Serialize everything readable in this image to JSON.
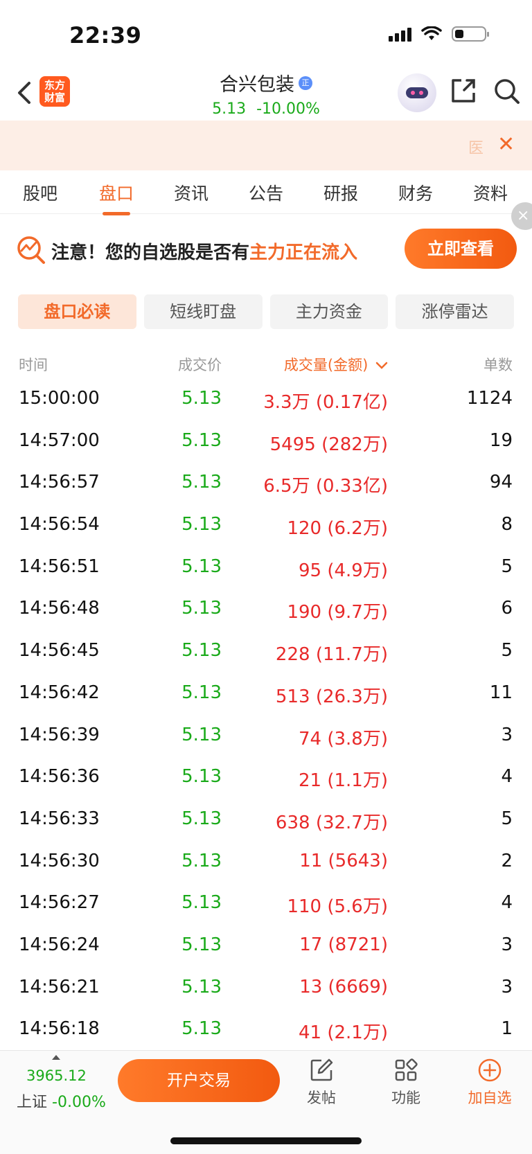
{
  "status_bar": {
    "time": "22:39"
  },
  "header": {
    "logo_line1": "东方",
    "logo_line2": "财富",
    "stock_name": "合兴包装",
    "stock_badge": "正",
    "price": "5.13",
    "change": "-10.00%"
  },
  "banner": {
    "doc_char": "医",
    "close": "✕"
  },
  "tabs": [
    {
      "label": "股吧"
    },
    {
      "label": "盘口"
    },
    {
      "label": "资讯"
    },
    {
      "label": "公告"
    },
    {
      "label": "研报"
    },
    {
      "label": "财务"
    },
    {
      "label": "资料"
    }
  ],
  "notice": {
    "prefix": "注意！您的自选股是否有",
    "highlight": "主力正在流入",
    "button": "立即查看"
  },
  "segments": [
    {
      "label": "盘口必读"
    },
    {
      "label": "短线盯盘"
    },
    {
      "label": "主力资金"
    },
    {
      "label": "涨停雷达"
    }
  ],
  "table": {
    "headers": {
      "time": "时间",
      "price": "成交价",
      "volume": "成交量(金额)",
      "count": "单数"
    },
    "rows": [
      {
        "time": "15:00:00",
        "price": "5.13",
        "volume": "3.3万 (0.17亿)",
        "count": "1124"
      },
      {
        "time": "14:57:00",
        "price": "5.13",
        "volume": "5495 (282万)",
        "count": "19"
      },
      {
        "time": "14:56:57",
        "price": "5.13",
        "volume": "6.5万 (0.33亿)",
        "count": "94"
      },
      {
        "time": "14:56:54",
        "price": "5.13",
        "volume": "120 (6.2万)",
        "count": "8"
      },
      {
        "time": "14:56:51",
        "price": "5.13",
        "volume": "95 (4.9万)",
        "count": "5"
      },
      {
        "time": "14:56:48",
        "price": "5.13",
        "volume": "190 (9.7万)",
        "count": "6"
      },
      {
        "time": "14:56:45",
        "price": "5.13",
        "volume": "228 (11.7万)",
        "count": "5"
      },
      {
        "time": "14:56:42",
        "price": "5.13",
        "volume": "513 (26.3万)",
        "count": "11"
      },
      {
        "time": "14:56:39",
        "price": "5.13",
        "volume": "74 (3.8万)",
        "count": "3"
      },
      {
        "time": "14:56:36",
        "price": "5.13",
        "volume": "21 (1.1万)",
        "count": "4"
      },
      {
        "time": "14:56:33",
        "price": "5.13",
        "volume": "638 (32.7万)",
        "count": "5"
      },
      {
        "time": "14:56:30",
        "price": "5.13",
        "volume": "11 (5643)",
        "count": "2"
      },
      {
        "time": "14:56:27",
        "price": "5.13",
        "volume": "110 (5.6万)",
        "count": "4"
      },
      {
        "time": "14:56:24",
        "price": "5.13",
        "volume": "17 (8721)",
        "count": "3"
      },
      {
        "time": "14:56:21",
        "price": "5.13",
        "volume": "13 (6669)",
        "count": "3"
      },
      {
        "time": "14:56:18",
        "price": "5.13",
        "volume": "41 (2.1万)",
        "count": "1"
      }
    ]
  },
  "bottom_bar": {
    "index_value": "3965.12",
    "index_name": "上证",
    "index_change": "-0.00%",
    "trade_button": "开户交易",
    "post": "发帖",
    "functions": "功能",
    "add_watch": "加自选"
  },
  "colors": {
    "accent": "#f26a2a",
    "down_green": "#1aaa1a",
    "up_red": "#e82a2a"
  }
}
